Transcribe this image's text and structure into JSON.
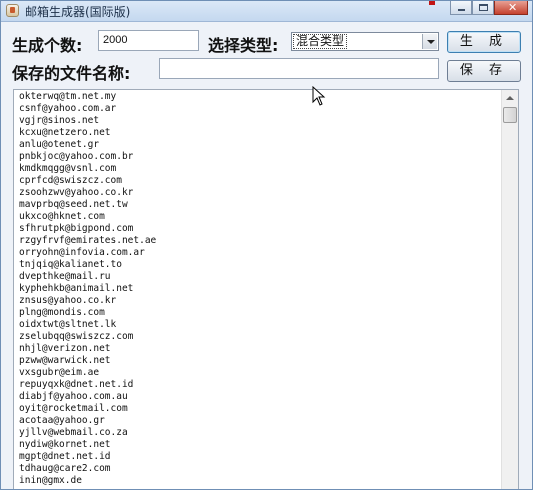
{
  "window": {
    "title": "邮箱生成器(国际版)",
    "controls": [
      "minimize-icon",
      "maximize-icon",
      "close-icon"
    ]
  },
  "form": {
    "count_label": "生成个数:",
    "count_value": "2000",
    "type_label": "选择类型:",
    "type_selected": "混合类型",
    "generate_button": "生 成",
    "filename_label": "保存的文件名称:",
    "filename_value": "",
    "save_button": "保 存"
  },
  "colors": {
    "titlebar": "#c4d8ef",
    "window_bg": "#eef2f8",
    "close_button": "#c5412e"
  },
  "emails": [
    "okterwq@tm.net.my",
    "csnf@yahoo.com.ar",
    "vgjr@sinos.net",
    "kcxu@netzero.net",
    "anlu@otenet.gr",
    "pnbkjoc@yahoo.com.br",
    "kmdkmqgg@vsnl.com",
    "cprfcd@swiszcz.com",
    "zsoohzwv@yahoo.co.kr",
    "mavprbq@seed.net.tw",
    "ukxco@hknet.com",
    "sfhrutpk@bigpond.com",
    "rzgyfrvf@emirates.net.ae",
    "orryohn@infovia.com.ar",
    "tnjqiq@kalianet.to",
    "dvepthke@mail.ru",
    "kyphehkb@animail.net",
    "znsus@yahoo.co.kr",
    "plng@mondis.com",
    "oidxtwt@sltnet.lk",
    "zselubqq@swiszcz.com",
    "nhjl@verizon.net",
    "pzww@warwick.net",
    "vxsgubr@eim.ae",
    "repuyqxk@dnet.net.id",
    "diabjf@yahoo.com.au",
    "oyit@rocketmail.com",
    "acotaa@yahoo.gr",
    "yjllv@webmail.co.za",
    "nydiw@kornet.net",
    "mgpt@dnet.net.id",
    "tdhaug@care2.com",
    "inin@gmx.de"
  ]
}
